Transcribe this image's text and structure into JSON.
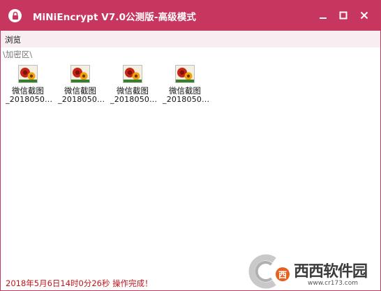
{
  "window": {
    "title": "MiNiEncrypt V7.0公测版-高级模式",
    "accent": "#c7365e"
  },
  "menu": {
    "items": [
      "浏览"
    ]
  },
  "path": "\\加密区\\",
  "files": [
    {
      "name_line1": "微信截图",
      "name_line2": "_2018050..."
    },
    {
      "name_line1": "微信截图",
      "name_line2": "_2018050..."
    },
    {
      "name_line1": "微信截图",
      "name_line2": "_2018050..."
    },
    {
      "name_line1": "微信截图",
      "name_line2": "_2018050..."
    }
  ],
  "status": {
    "text": "2018年5月6日14时0分26秒   操作完成！",
    "color": "#c0141c"
  },
  "watermark": {
    "brand": "西西软件园",
    "url": "www.cr173.com"
  },
  "icons": {
    "app": "lock-icon",
    "minimize": "minimize-icon",
    "maximize": "maximize-icon",
    "close": "close-icon",
    "file": "image-file-icon"
  }
}
